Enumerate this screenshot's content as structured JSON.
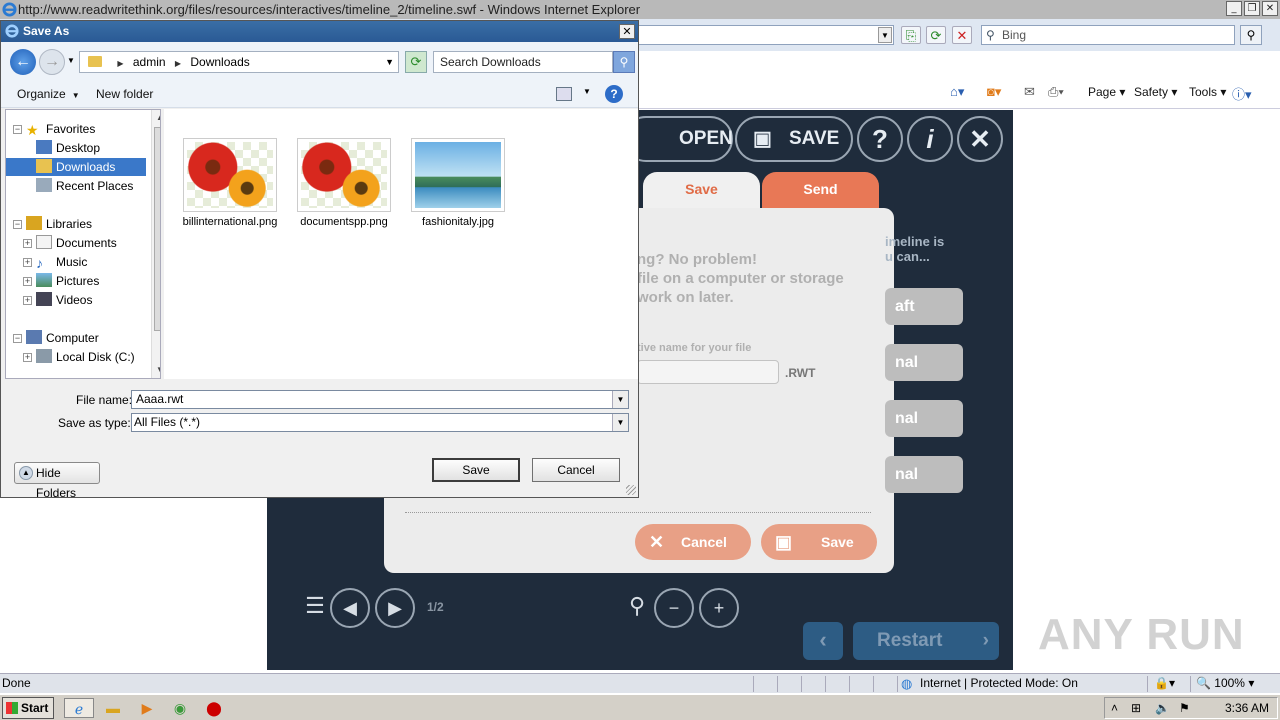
{
  "ie": {
    "title": "http://www.readwritethink.org/files/resources/interactives/timeline_2/timeline.swf - Windows Internet Explorer",
    "search_placeholder": "Bing",
    "commands": {
      "page": "Page",
      "safety": "Safety",
      "tools": "Tools"
    },
    "status": {
      "left": "Done",
      "zone": "Internet | Protected Mode: On",
      "zoom": "100%"
    }
  },
  "flash": {
    "open_label": "OPEN",
    "save_label": "SAVE",
    "tabs": {
      "save": "Save",
      "send": "Send"
    },
    "panel_lines": [
      "ng? No problem!",
      "file on a computer or storage",
      "work on later."
    ],
    "right_lines": [
      "imeline is",
      "u can..."
    ],
    "side_buttons": [
      "aft",
      "nal",
      "nal",
      "nal"
    ],
    "name_label": "tive name for your file",
    "extension": ".RWT",
    "cancel_label": "Cancel",
    "save_btn_label": "Save",
    "page_indicator": "1/2",
    "restart_label": "Restart",
    "watermark": "ANY RUN"
  },
  "dialog": {
    "title": "Save As",
    "breadcrumb": [
      "admin",
      "Downloads"
    ],
    "search_placeholder": "Search Downloads",
    "toolbar": {
      "organize": "Organize",
      "new_folder": "New folder"
    },
    "tree": {
      "favorites": "Favorites",
      "desktop": "Desktop",
      "downloads": "Downloads",
      "recent": "Recent Places",
      "libraries": "Libraries",
      "documents": "Documents",
      "music": "Music",
      "pictures": "Pictures",
      "videos": "Videos",
      "computer": "Computer",
      "local_disk": "Local Disk (C:)"
    },
    "files": [
      {
        "name": "billinternational.png"
      },
      {
        "name": "documentspp.png"
      },
      {
        "name": "fashionitaly.jpg"
      }
    ],
    "file_name_label": "File name:",
    "file_name_value": "Aaaa.rwt",
    "save_type_label": "Save as type:",
    "save_type_value": "All Files (*.*)",
    "hide_folders": "Hide Folders",
    "save_button": "Save",
    "cancel_button": "Cancel"
  },
  "taskbar": {
    "start": "Start",
    "clock": "3:36 AM"
  }
}
